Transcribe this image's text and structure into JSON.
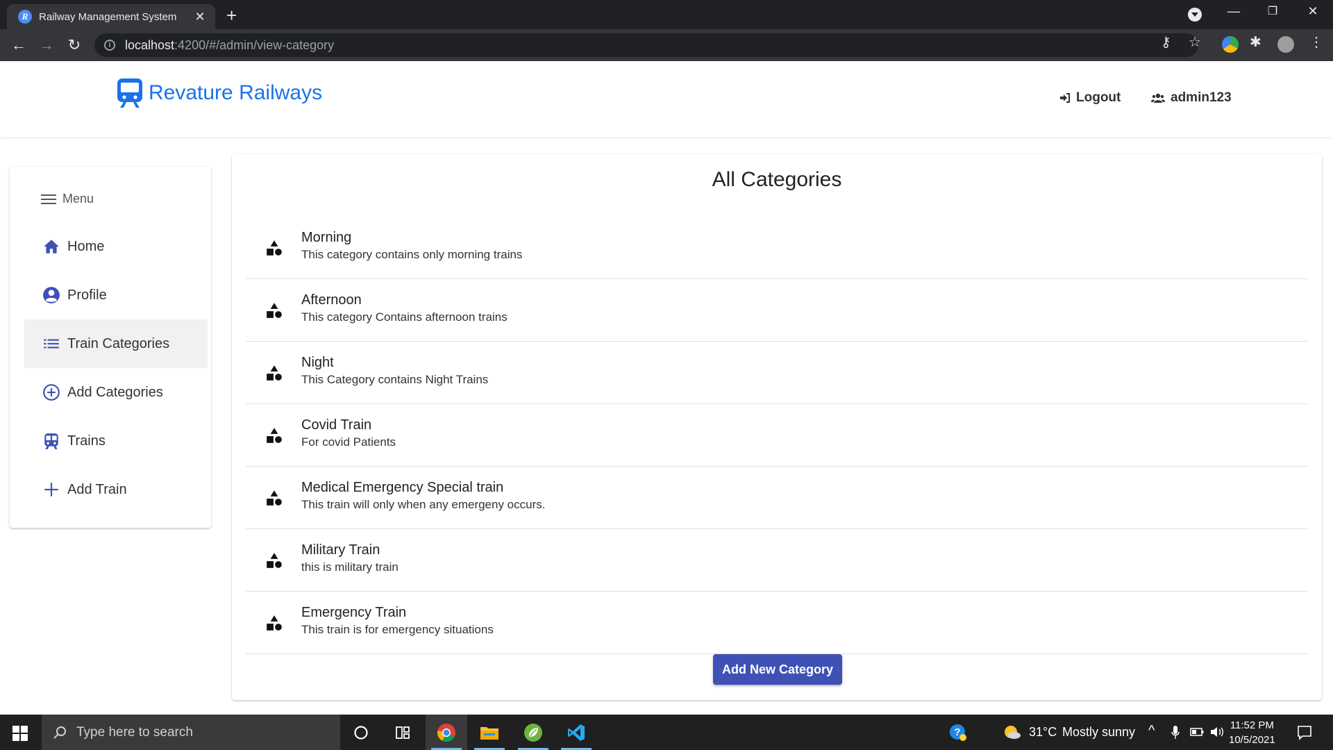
{
  "browser": {
    "tab_title": "Railway Management System",
    "favicon_letter": "R",
    "url_host": "localhost",
    "url_path": ":4200/#/admin/view-category"
  },
  "header": {
    "brand": "Revature Railways",
    "logout_label": "Logout",
    "user_label": "admin123"
  },
  "sidebar": {
    "menu_label": "Menu",
    "items": [
      {
        "label": "Home",
        "icon": "home-icon"
      },
      {
        "label": "Profile",
        "icon": "account-circle-icon"
      },
      {
        "label": "Train Categories",
        "icon": "list-icon",
        "active": true
      },
      {
        "label": "Add Categories",
        "icon": "add-circle-icon"
      },
      {
        "label": "Trains",
        "icon": "train-icon"
      },
      {
        "label": "Add Train",
        "icon": "plus-icon"
      }
    ]
  },
  "main": {
    "title": "All Categories",
    "categories": [
      {
        "name": "Morning",
        "description": "This category contains only morning trains"
      },
      {
        "name": "Afternoon",
        "description": "This category Contains afternoon trains"
      },
      {
        "name": "Night",
        "description": "This Category contains Night Trains"
      },
      {
        "name": "Covid Train",
        "description": "For covid Patients"
      },
      {
        "name": "Medical Emergency Special train",
        "description": "This train will only when any emergeny occurs."
      },
      {
        "name": "Military Train",
        "description": "this is military train"
      },
      {
        "name": "Emergency Train",
        "description": "This train is for emergency situations"
      }
    ],
    "add_button_label": "Add New Category"
  },
  "taskbar": {
    "search_placeholder": "Type here to search",
    "weather_temp": "31°C",
    "weather_text": "Mostly sunny",
    "time": "11:52 PM",
    "date": "10/5/2021"
  },
  "colors": {
    "brand": "#1a73e8",
    "primary_button": "#3f51b5",
    "nav_icon": "#3f51b5"
  }
}
